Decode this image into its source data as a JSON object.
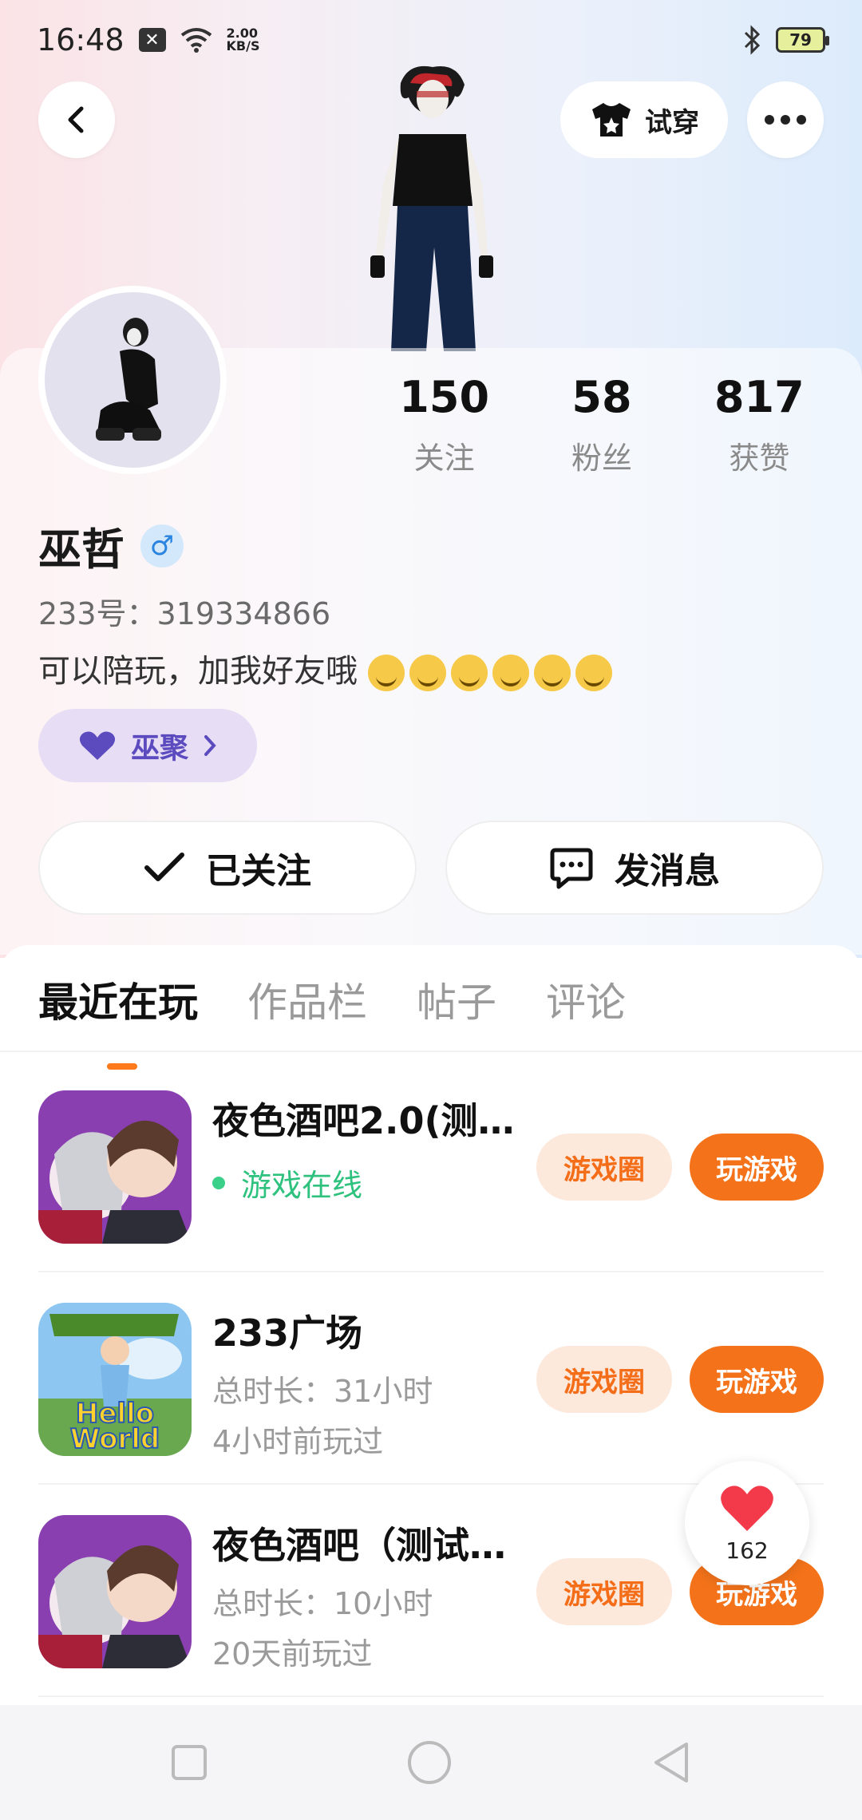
{
  "status_bar": {
    "time": "16:48",
    "net_speed_value": "2.00",
    "net_speed_unit": "KB/S",
    "battery": "79"
  },
  "header": {
    "try_on_label": "试穿"
  },
  "profile": {
    "stats": [
      {
        "value": "150",
        "label": "关注"
      },
      {
        "value": "58",
        "label": "粉丝"
      },
      {
        "value": "817",
        "label": "获赞"
      }
    ],
    "name": "巫哲",
    "gender_symbol": "♂",
    "uid": "233号：319334866",
    "bio": "可以陪玩，加我好友哦",
    "tag_label": "巫聚"
  },
  "actions": {
    "follow_label": "已关注",
    "message_label": "发消息"
  },
  "tabs": [
    {
      "label": "最近在玩"
    },
    {
      "label": "作品栏"
    },
    {
      "label": "帖子"
    },
    {
      "label": "评论"
    }
  ],
  "games": [
    {
      "title": "夜色酒吧2.0(测…",
      "line1": "游戏在线",
      "line2": "",
      "circle_label": "游戏圈",
      "play_label": "玩游戏"
    },
    {
      "title": "233广场",
      "line1": "总时长：31小时",
      "line2": "4小时前玩过",
      "circle_label": "游戏圈",
      "play_label": "玩游戏"
    },
    {
      "title": "夜色酒吧（测试…",
      "line1": "总时长：10小时",
      "line2": "20天前玩过",
      "circle_label": "游戏圈",
      "play_label": "玩游戏"
    }
  ],
  "like_float": {
    "count": "162"
  },
  "colors": {
    "accent": "#f4731a",
    "accent_soft": "#fde8dc",
    "online": "#2ec27e",
    "tag_bg": "#e7ddf5",
    "tag_text": "#5b4bbf"
  }
}
